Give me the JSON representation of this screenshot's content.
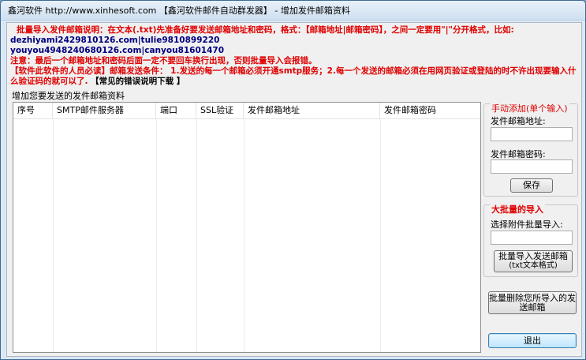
{
  "window": {
    "title": "鑫河软件 http://www.xinhesoft.com 【鑫河软件邮件自动群发器】 - 增加发件邮箱资料"
  },
  "instructions": {
    "line1": "批量导入发件邮箱说明：在文本(.txt)先准备好要发送邮箱地址和密码，格式：【邮箱地址|邮箱密码】，之间一定要用\"|\"分开格式，比如:",
    "example1": "dezhiyami2429810126.com|tulie9810899220",
    "example2": "youyou4948240680126.com|canyou81601470",
    "line4": "注意：最后一个邮箱地址和密码后面一定不要回车换行出现，否则批量导入会报错。",
    "line5_prefix": "【软件此软件的人员必读】邮箱发送条件：",
    "line5_body": "1.发送的每一个邮箱必须开通smtp服务；2.每一个发送的邮箱必须在用网页验证或登陆的时不许出现要输入什么验证码的就可以了.",
    "line5_link": "【常见的错误说明下载 】"
  },
  "mailbox_list": {
    "group_title": "增加您要发送的发件邮箱资料",
    "columns": [
      "序号",
      "SMTP邮件服务器",
      "端口",
      "SSL验证",
      "发件邮箱地址",
      "发件邮箱密码"
    ],
    "rows": []
  },
  "manual_add": {
    "title": "手动添加(单个输入)",
    "address_label": "发件邮箱地址:",
    "address_value": "",
    "password_label": "发件邮箱密码:",
    "password_value": "",
    "save_button": "保存"
  },
  "bulk_import": {
    "title": "大批量的导入",
    "file_label": "选择附件批量导入:",
    "file_value": "",
    "import_button_line1": "批量导入发送邮箱",
    "import_button_line2": "(txt文本格式)"
  },
  "actions": {
    "bulk_delete_line1": "批量删除您所导入的发",
    "bulk_delete_line2": "送邮箱",
    "exit_button": "退出"
  }
}
